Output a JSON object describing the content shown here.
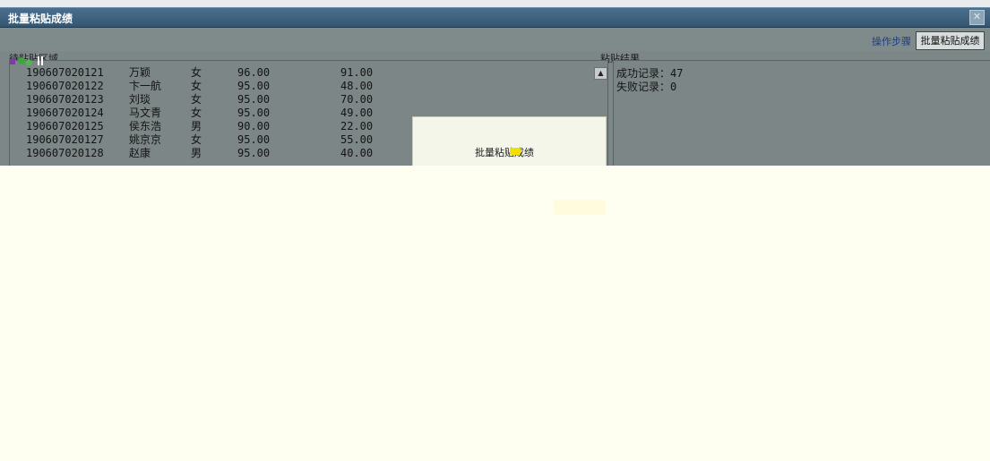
{
  "window": {
    "title": "批量粘贴成绩",
    "close_icon": "close-icon"
  },
  "toolbar": {
    "steps_link": "操作步骤",
    "batch_button": "批量粘贴成绩"
  },
  "left_area": {
    "label": "待粘贴区域",
    "rows": [
      {
        "id": "190607020121",
        "name": "万颖",
        "sex": "女",
        "score1": "96.00",
        "score2": "91.00"
      },
      {
        "id": "190607020122",
        "name": "卞一航",
        "sex": "女",
        "score1": "95.00",
        "score2": "48.00"
      },
      {
        "id": "190607020123",
        "name": "刘琰",
        "sex": "女",
        "score1": "95.00",
        "score2": "70.00"
      },
      {
        "id": "190607020124",
        "name": "马文青",
        "sex": "女",
        "score1": "95.00",
        "score2": "49.00"
      },
      {
        "id": "190607020125",
        "name": "侯东浩",
        "sex": "男",
        "score1": "90.00",
        "score2": "22.00"
      },
      {
        "id": "190607020127",
        "name": "姚京京",
        "sex": "女",
        "score1": "95.00",
        "score2": "55.00"
      },
      {
        "id": "190607020128",
        "name": "赵康",
        "sex": "男",
        "score1": "95.00",
        "score2": "40.00"
      }
    ]
  },
  "right_area": {
    "label": "粘贴结果",
    "success_line": "成功记录：47",
    "fail_line": "失败记录：0"
  },
  "modal": {
    "text": "批量粘贴成绩"
  },
  "colors": {
    "title_bar": "#3e6380",
    "panel_bg": "#7c8686",
    "overlay": "#fefff0",
    "link": "#1e3f7a"
  }
}
